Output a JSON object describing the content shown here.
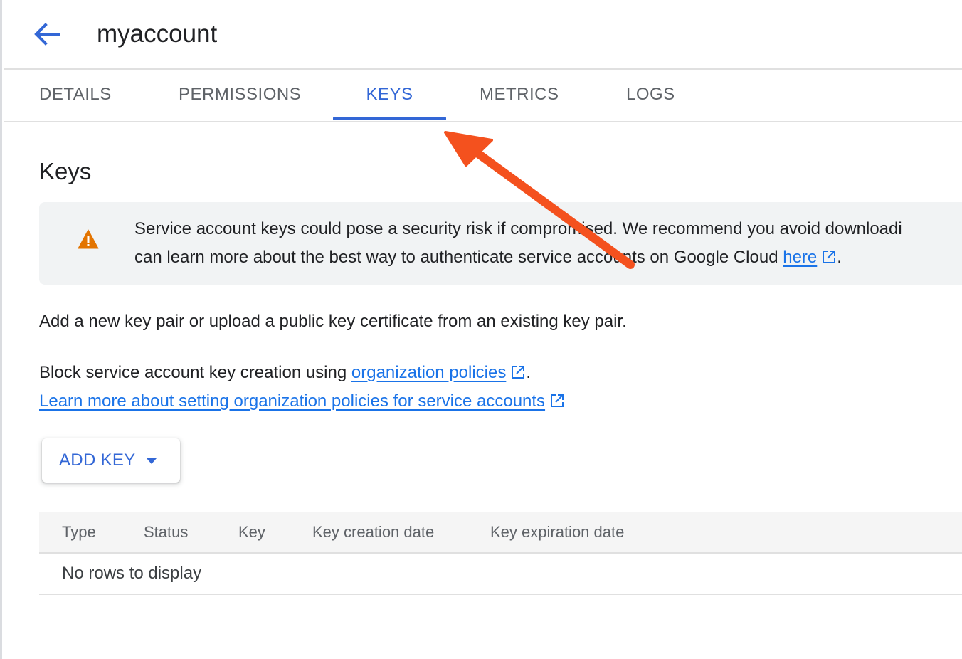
{
  "header": {
    "title": "myaccount",
    "back_icon": "arrow-back-icon"
  },
  "tabs": [
    {
      "label": "DETAILS",
      "active": false
    },
    {
      "label": "PERMISSIONS",
      "active": false
    },
    {
      "label": "KEYS",
      "active": true
    },
    {
      "label": "METRICS",
      "active": false
    },
    {
      "label": "LOGS",
      "active": false
    }
  ],
  "keys": {
    "heading": "Keys",
    "banner": {
      "icon": "warning-icon",
      "line1": "Service account keys could pose a security risk if compromised. We recommend you avoid downloadi",
      "line2_prefix": "can learn more about the best way to authenticate service accounts on Google Cloud ",
      "line2_link": "here",
      "line2_suffix": "."
    },
    "description": "Add a new key pair or upload a public key certificate from an existing key pair.",
    "block_prefix": "Block service account key creation using ",
    "block_link": "organization policies",
    "block_suffix": ".",
    "learn_link": "Learn more about setting organization policies for service accounts",
    "add_key_label": "ADD KEY"
  },
  "table": {
    "columns": [
      "Type",
      "Status",
      "Key",
      "Key creation date",
      "Key expiration date"
    ],
    "rows": [],
    "empty_message": "No rows to display"
  },
  "colors": {
    "accent": "#3367d6",
    "link": "#1a73e8",
    "warning": "#e37400",
    "annotation_arrow": "#f4511e"
  }
}
